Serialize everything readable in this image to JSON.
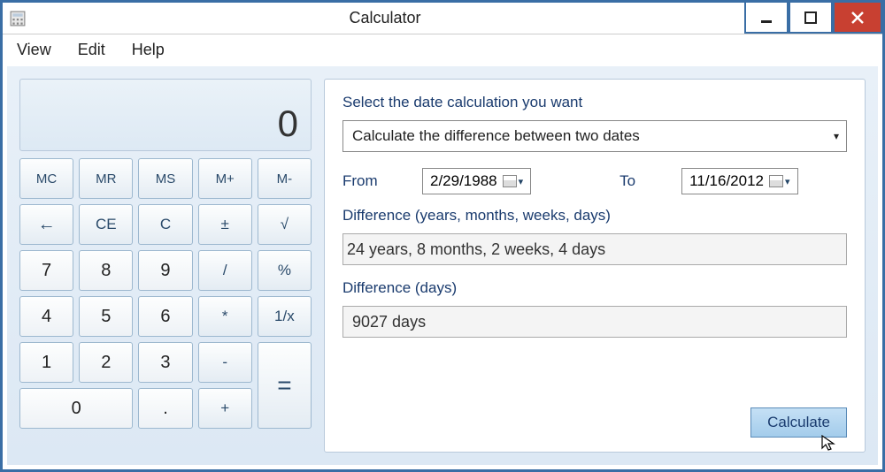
{
  "window": {
    "title": "Calculator"
  },
  "menu": {
    "view": "View",
    "edit": "Edit",
    "help": "Help"
  },
  "calc": {
    "display": "0",
    "mc": "MC",
    "mr": "MR",
    "ms": "MS",
    "mplus": "M+",
    "mminus": "M-",
    "back": "←",
    "ce": "CE",
    "c": "C",
    "pm": "±",
    "sqrt": "√",
    "n7": "7",
    "n8": "8",
    "n9": "9",
    "div": "/",
    "pct": "%",
    "n4": "4",
    "n5": "5",
    "n6": "6",
    "mul": "*",
    "inv": "1/x",
    "n1": "1",
    "n2": "2",
    "n3": "3",
    "sub": "-",
    "eq": "=",
    "n0": "0",
    "dot": ".",
    "add": "+"
  },
  "date": {
    "select_label": "Select the date calculation you want",
    "mode": "Calculate the difference between two dates",
    "from_label": "From",
    "from_value": "2/29/1988",
    "to_label": "To",
    "to_value": "11/16/2012",
    "diff_full_label": "Difference (years, months, weeks, days)",
    "diff_full_value": "24 years, 8 months, 2 weeks, 4 days",
    "diff_days_label": "Difference (days)",
    "diff_days_value": "9027 days",
    "calculate": "Calculate"
  }
}
